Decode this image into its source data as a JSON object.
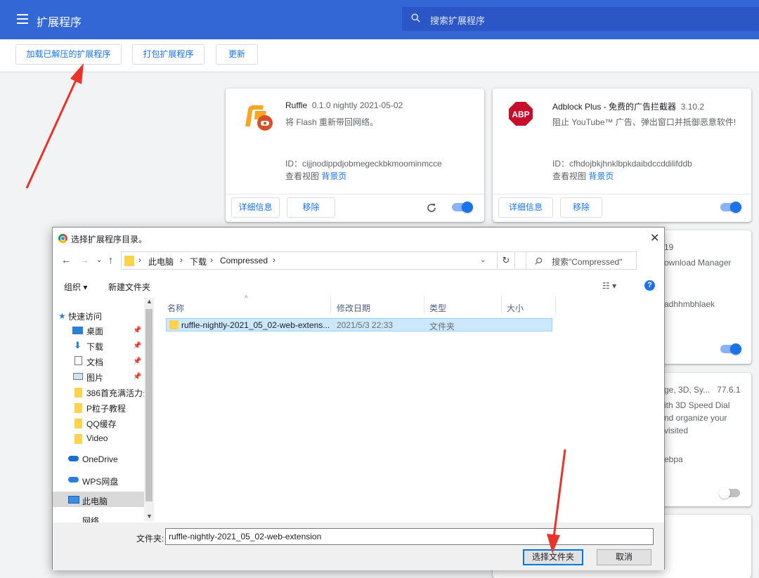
{
  "header": {
    "title": "扩展程序",
    "search_placeholder": "搜索扩展程序"
  },
  "toolbar": {
    "load_unpacked": "加载已解压的扩展程序",
    "pack": "打包扩展程序",
    "update": "更新"
  },
  "cards": [
    {
      "name": "Ruffle",
      "version": "0.1.0 nightly 2021-05-02",
      "description": "将 Flash 重新带回网络。",
      "id": "ID：cijjnodippdjobmegeckbkmoominmcce",
      "views_label": "查看视图",
      "views_link": "背景页",
      "details": "详细信息",
      "remove": "移除",
      "enabled": true
    },
    {
      "name": "Adblock Plus - 免费的广告拦截器",
      "version": "3.10.2",
      "description": "阻止 YouTube™ 广告、弹出窗口并抵御恶意软件!",
      "id": "ID：cfhdojbkjhnklbpkdaibdccddilifddb",
      "views_label": "查看视图",
      "views_link": "背景页",
      "details": "详细信息",
      "remove": "移除",
      "enabled": true,
      "icon_text": "ABP"
    }
  ],
  "partial_cards": {
    "c3": {
      "version": "19",
      "desc": "ownload Manager",
      "id": "adhhmbhlaek",
      "enabled": true
    },
    "c4": {
      "title": "ge, 3D, Sy...",
      "version": "77.6.1",
      "line1": "ith 3D Speed Dial",
      "line2": "nd organize your",
      "line3": "visited",
      "id": "ebpa",
      "enabled": false
    }
  },
  "dialog": {
    "title": "选择扩展程序目录。",
    "breadcrumb": [
      "此电脑",
      "下载",
      "Compressed"
    ],
    "search_placeholder": "搜索\"Compressed\"",
    "organize": "组织 ▾",
    "new_folder": "新建文件夹",
    "nav": [
      "快速访问",
      "桌面",
      "下载",
      "文档",
      "图片",
      "386首充满活力云",
      "P粒子教程",
      "QQ缓存",
      "Video",
      "OneDrive",
      "WPS网盘",
      "此电脑",
      "网络"
    ],
    "columns": {
      "name": "名称",
      "date": "修改日期",
      "type": "类型",
      "size": "大小"
    },
    "files": [
      {
        "name": "ruffle-nightly-2021_05_02-web-extens...",
        "date": "2021/5/3 22:33",
        "type": "文件夹"
      }
    ],
    "folder_label": "文件夹:",
    "folder_value": "ruffle-nightly-2021_05_02-web-extension",
    "select_button": "选择文件夹",
    "cancel_button": "取消"
  },
  "colors": {
    "header": "#3367d6",
    "accent": "#1a73e8",
    "annotation_arrow": "#e8332a"
  }
}
